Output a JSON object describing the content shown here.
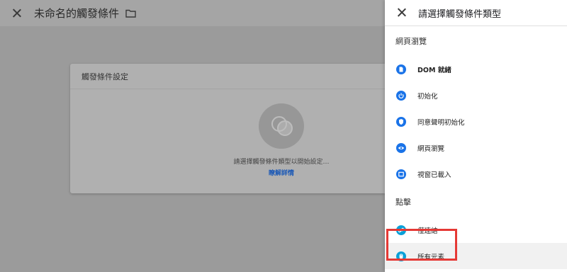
{
  "editor": {
    "title": "未命名的觸發條件",
    "card": {
      "title": "觸發條件設定",
      "hint": "請選擇觸發條件類型以開始設定…",
      "learn_more": "瞭解詳情"
    }
  },
  "panel": {
    "title": "請選擇觸發條件類型",
    "sections": [
      {
        "heading": "網頁瀏覽",
        "items": [
          {
            "label": "DOM 就緒",
            "icon": "document-icon"
          },
          {
            "label": "初始化",
            "icon": "power-icon"
          },
          {
            "label": "同意聲明初始化",
            "icon": "shield-icon"
          },
          {
            "label": "網頁瀏覽",
            "icon": "eye-icon"
          },
          {
            "label": "視窗已載入",
            "icon": "window-icon"
          }
        ]
      },
      {
        "heading": "點擊",
        "items": [
          {
            "label": "僅連結",
            "icon": "link-icon"
          },
          {
            "label": "所有元素",
            "icon": "mouse-icon"
          }
        ]
      }
    ]
  },
  "colors": {
    "accent": "#1a73e8",
    "click_accent": "#0aa0d8",
    "highlight": "#e53935"
  }
}
